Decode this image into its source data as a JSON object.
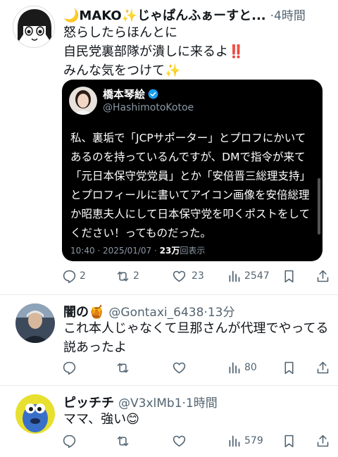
{
  "posts": [
    {
      "name": "🌙MAKO✨じゃぱんふぁーすと...",
      "dot": "·",
      "time": "4時間",
      "lines": [
        "怒らしたらほんとに",
        "自民党裏部隊が潰しに来るよ‼️",
        "みんな気をつけて✨"
      ],
      "quote": {
        "name": "橋本琴絵",
        "handle": "@HashimotoKotoe",
        "text": "私、裏垢で「JCPサポーター」とプロフにかいてあるのを持っているんですが、DMで指令が来て「元日本保守党党員」とか「安倍晋三総理支持」とプロフィールに書いてアイコン画像を安倍総理か昭恵夫人にして日本保守党を叩くポストをしてください！ってものだった。",
        "time": "10:40 · 2025/01/07 · ",
        "views": "23万",
        "views_label": "回表示"
      },
      "actions": {
        "replies": "2",
        "reposts": "2",
        "likes": "23",
        "views": "2547"
      }
    },
    {
      "name": "闇の🍯",
      "handle": "@Gontaxi_6438",
      "dot": "·",
      "time": "13分",
      "lines": [
        "これ本人じゃなくて旦那さんが代理でやってる",
        "説あったよ"
      ],
      "actions": {
        "replies": "",
        "reposts": "",
        "likes": "",
        "views": "80"
      }
    },
    {
      "name": "ピッチチ",
      "handle": "@V3xlMb1",
      "dot": "·",
      "time": "1時間",
      "lines": [
        "ママ、強い😊"
      ],
      "actions": {
        "replies": "",
        "reposts": "",
        "likes": "",
        "views": "579"
      }
    }
  ],
  "colors": {
    "text": "#0f1419",
    "muted": "#536471",
    "verified": "#1d9bf0",
    "quote_bg": "#000000"
  }
}
